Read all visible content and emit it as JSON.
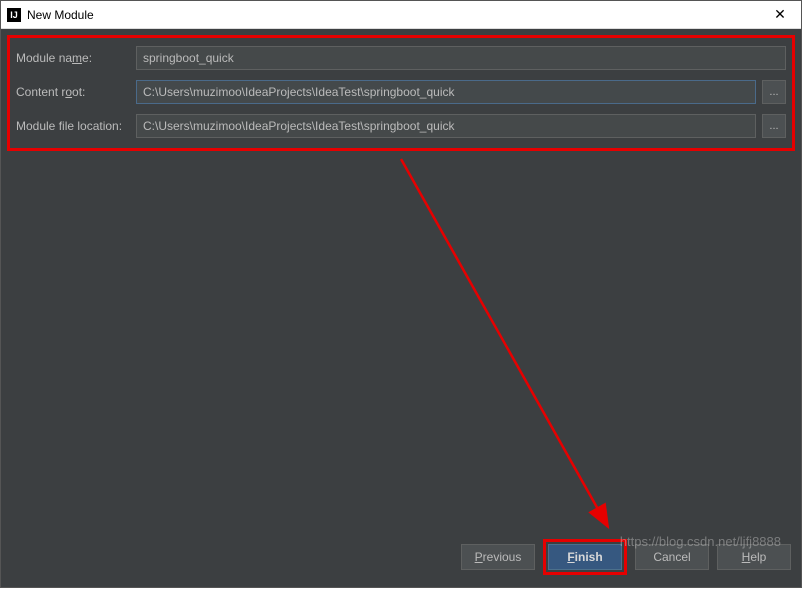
{
  "window": {
    "title": "New Module",
    "close_glyph": "✕",
    "icon_text": "IJ"
  },
  "form": {
    "module_name_label_pre": "Module na",
    "module_name_label_ul": "m",
    "module_name_label_post": "e:",
    "module_name_value": "springboot_quick",
    "content_root_label_pre": "Content r",
    "content_root_label_ul": "o",
    "content_root_label_post": "ot:",
    "content_root_value": "C:\\Users\\muzimoo\\IdeaProjects\\IdeaTest\\springboot_quick",
    "module_file_label": "Module file location:",
    "module_file_value": "C:\\Users\\muzimoo\\IdeaProjects\\IdeaTest\\springboot_quick",
    "browse_glyph": "..."
  },
  "buttons": {
    "previous_ul": "P",
    "previous_rest": "revious",
    "finish_ul": "F",
    "finish_rest": "inish",
    "cancel": "Cancel",
    "help_ul": "H",
    "help_rest": "elp"
  },
  "watermark": "https://blog.csdn.net/ljfj8888"
}
